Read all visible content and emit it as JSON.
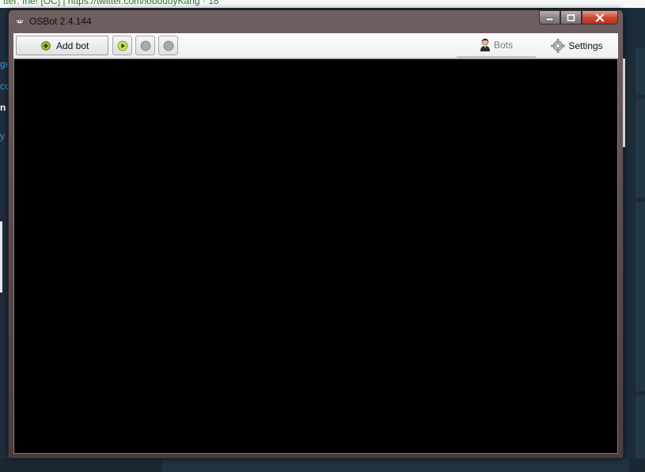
{
  "window": {
    "title": "OSBot 2.4.144",
    "app_icon": "osbot-helmet-icon"
  },
  "caption_buttons": {
    "minimize": "minimize-icon",
    "maximize": "maximize-icon",
    "close": "close-icon"
  },
  "toolbar": {
    "add_bot_label": "Add bot",
    "add_bot_icon": "plus-circle-icon",
    "play_icon": "play-icon",
    "pause_icon": "pause-icon",
    "stop_icon": "stop-icon"
  },
  "tabs": {
    "bots_label": "Bots",
    "bots_icon": "user-icon",
    "settings_label": "Settings",
    "settings_icon": "gear-icon"
  },
  "background": {
    "top_strip_text": "tter: Ihe! [OC] | https://twitter.com/lobbuuyKang · 18",
    "left_fragments": [
      "ge",
      "co",
      "n",
      "y"
    ]
  },
  "colors": {
    "window_frame": "#5a4a4c",
    "canvas": "#000000",
    "close_button": "#cc4a31",
    "play_accent": "#8fb82e"
  }
}
